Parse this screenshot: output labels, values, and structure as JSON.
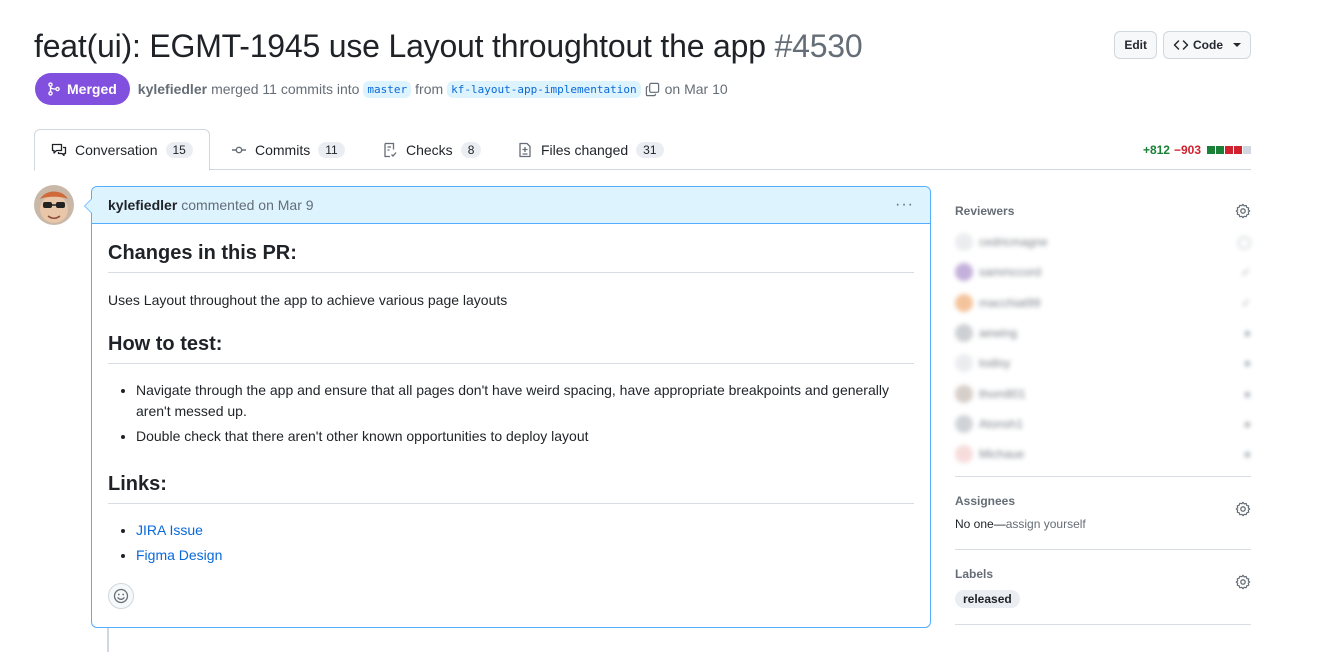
{
  "pr": {
    "title": "feat(ui): EGMT-1945 use Layout throughtout the app",
    "number": "#4530",
    "state": "Merged",
    "author": "kylefiedler",
    "merge_text": "merged 11 commits into",
    "base_branch": "master",
    "from_text": "from",
    "head_branch": "kf-layout-app-implementation",
    "date_text": "on Mar 10"
  },
  "actions": {
    "edit": "Edit",
    "code": "Code"
  },
  "tabs": [
    {
      "label": "Conversation",
      "count": "15",
      "icon": "comment-discussion-icon"
    },
    {
      "label": "Commits",
      "count": "11",
      "icon": "git-commit-icon"
    },
    {
      "label": "Checks",
      "count": "8",
      "icon": "checklist-icon"
    },
    {
      "label": "Files changed",
      "count": "31",
      "icon": "file-diff-icon"
    }
  ],
  "diffstat": {
    "additions": "+812",
    "deletions": "−903",
    "blocks": [
      "#1a7f37",
      "#1a7f37",
      "#cf222e",
      "#cf222e",
      "#d0d7de"
    ]
  },
  "comment": {
    "author": "kylefiedler",
    "meta": "commented on Mar 9",
    "more": "···",
    "heading_changes": "Changes in this PR:",
    "changes_text": "Uses Layout throughout the app to achieve various page layouts",
    "heading_test": "How to test:",
    "test_items": [
      "Navigate through the app and ensure that all pages don't have weird spacing, have appropriate breakpoints and generally aren't messed up.",
      "Double check that there aren't other known opportunities to deploy layout"
    ],
    "heading_links": "Links:",
    "links": [
      "JIRA Issue",
      "Figma Design"
    ]
  },
  "sidebar": {
    "reviewers_title": "Reviewers",
    "reviewers": [
      {
        "name": "cedricmagne",
        "color": "#e7e9ec",
        "status": "◯"
      },
      {
        "name": "sammccord",
        "color": "#b9a3d6",
        "status": "✓"
      },
      {
        "name": "macchiat99",
        "color": "#f2b98a",
        "status": "✓"
      },
      {
        "name": "aewing",
        "color": "#c5c8cc",
        "status": "●"
      },
      {
        "name": "todisy",
        "color": "#e7e9ec",
        "status": "●"
      },
      {
        "name": "thom801",
        "color": "#cfc6c0",
        "status": "●"
      },
      {
        "name": "Atonsh1",
        "color": "#c8ccd0",
        "status": "●"
      },
      {
        "name": "Michaue",
        "color": "#f6d6d6",
        "status": "●"
      }
    ],
    "assignees_title": "Assignees",
    "assignees_none": "No one—",
    "assignees_self": "assign yourself",
    "labels_title": "Labels",
    "label": "released"
  }
}
